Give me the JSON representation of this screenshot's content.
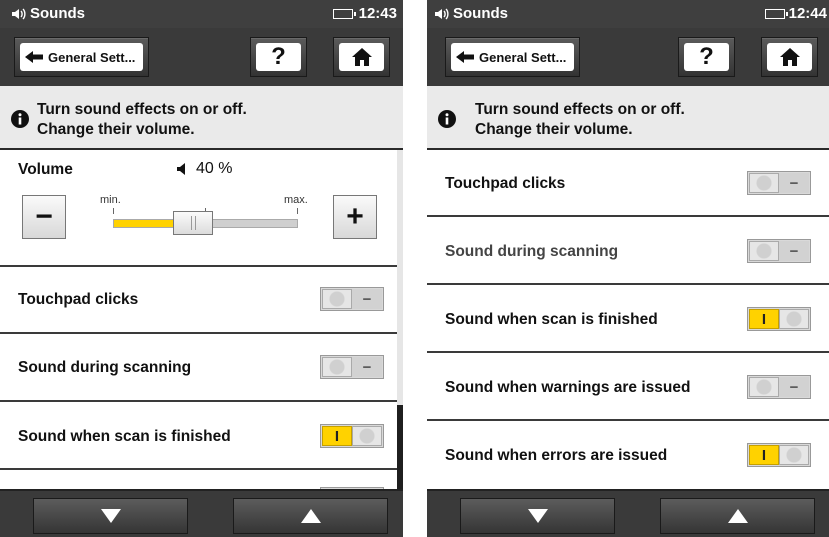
{
  "screens": [
    {
      "status": {
        "app_title": "Sounds",
        "time": "12:43",
        "app_icon": "speaker-waves-icon",
        "battery_icon": "battery-icon"
      },
      "nav": {
        "back_label": "General Sett...",
        "help_label": "?",
        "back_icon": "back-arrow-icon",
        "home_icon": "home-icon"
      },
      "info": {
        "line1": "Turn sound effects on or off.",
        "line2": "Change their volume.",
        "icon": "info-icon"
      },
      "volume": {
        "label": "Volume",
        "value_text": "40 %",
        "value_percent": 40,
        "min_label": "min.",
        "max_label": "max.",
        "decrease_label": "−",
        "increase_label": "+"
      },
      "rows": [
        {
          "label": "Touchpad clicks",
          "state": "off",
          "off_glyph": "−"
        },
        {
          "label": "Sound during scanning",
          "state": "off",
          "off_glyph": "−"
        },
        {
          "label": "Sound when scan is finished",
          "state": "on",
          "on_glyph": "I"
        }
      ]
    },
    {
      "status": {
        "app_title": "Sounds",
        "time": "12:44",
        "app_icon": "speaker-waves-icon",
        "battery_icon": "battery-icon"
      },
      "nav": {
        "back_label": "General Sett...",
        "help_label": "?",
        "back_icon": "back-arrow-icon",
        "home_icon": "home-icon"
      },
      "info": {
        "line1": "Turn sound effects on or off.",
        "line2": "Change their volume.",
        "icon": "info-icon"
      },
      "rows": [
        {
          "label": "Touchpad clicks",
          "state": "off",
          "off_glyph": "−"
        },
        {
          "label": "Sound during scanning",
          "state": "off",
          "off_glyph": "−"
        },
        {
          "label": "Sound when scan is finished",
          "state": "on",
          "on_glyph": "I"
        },
        {
          "label": "Sound when warnings are issued",
          "state": "off",
          "off_glyph": "−"
        },
        {
          "label": "Sound when errors are issued",
          "state": "on",
          "on_glyph": "I"
        }
      ]
    }
  ],
  "colors": {
    "accent_yellow": "#ffd200",
    "bar_dark": "#3a3a3a",
    "info_bg": "#eaeaea"
  },
  "bottom_nav": {
    "down_icon": "triangle-down-icon",
    "up_icon": "triangle-up-icon"
  }
}
